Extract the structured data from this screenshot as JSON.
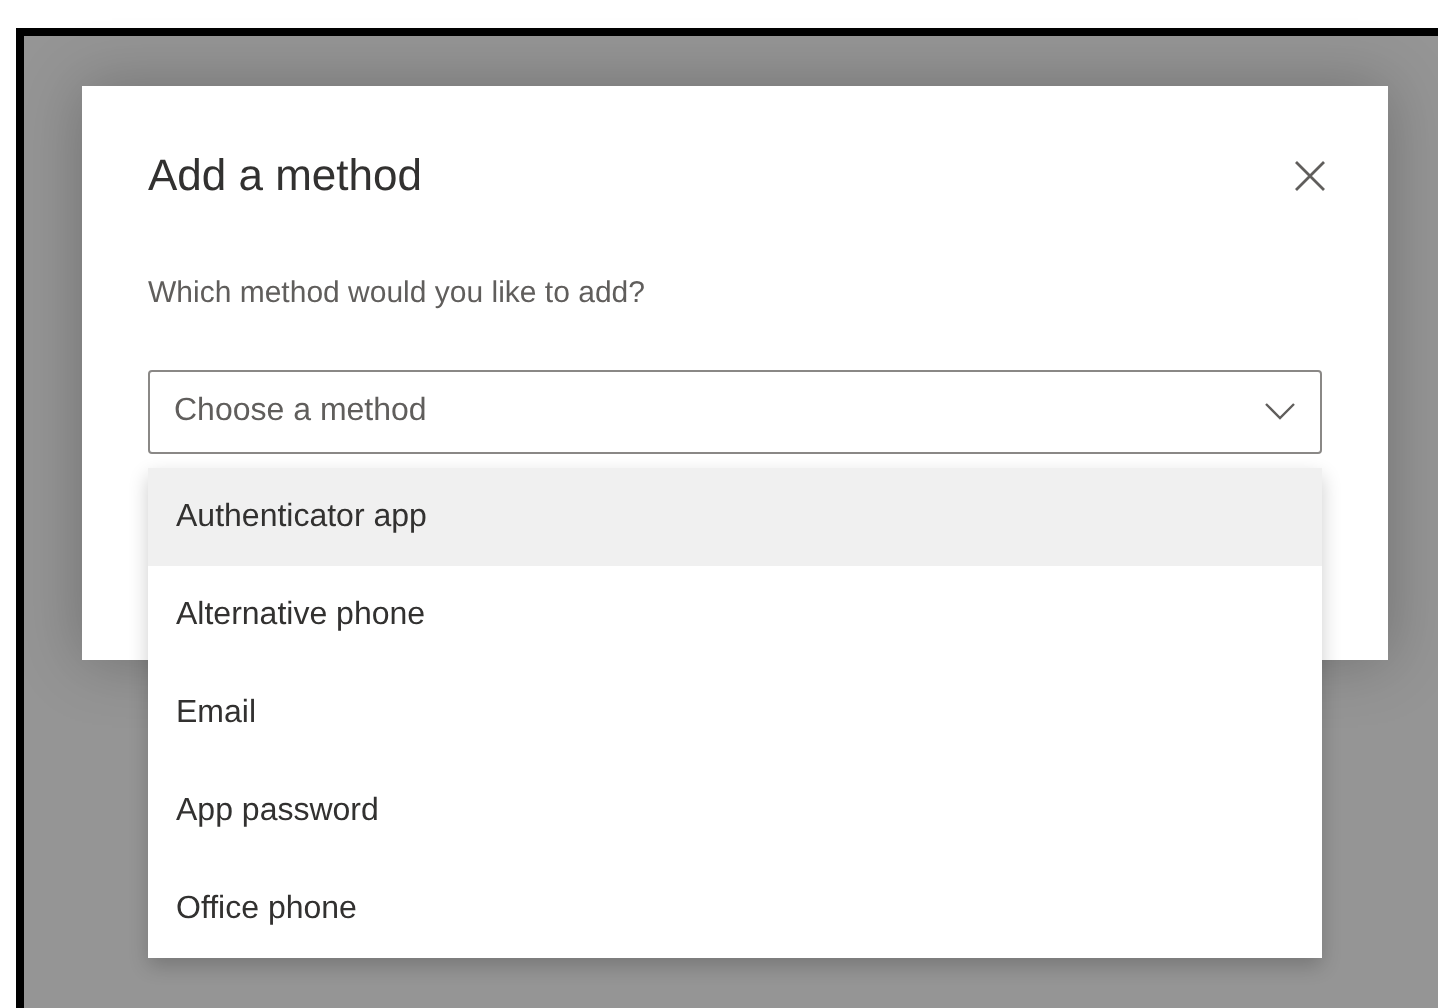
{
  "dialog": {
    "title": "Add a method",
    "prompt": "Which method would you like to add?"
  },
  "select": {
    "placeholder": "Choose a method",
    "expanded": true
  },
  "options": [
    {
      "label": "Authenticator app",
      "selected": true
    },
    {
      "label": "Alternative phone",
      "selected": false
    },
    {
      "label": "Email",
      "selected": false
    },
    {
      "label": "App password",
      "selected": false
    },
    {
      "label": "Office phone",
      "selected": false
    }
  ]
}
